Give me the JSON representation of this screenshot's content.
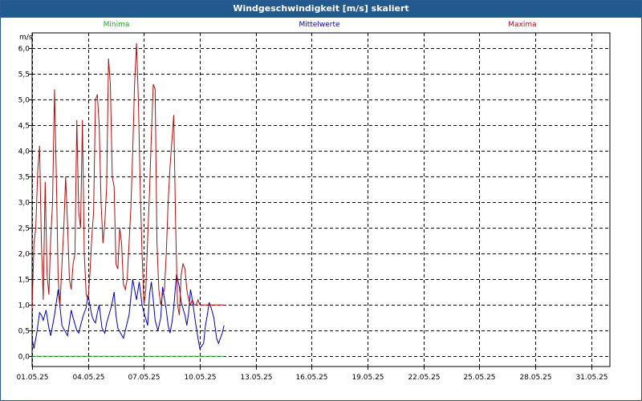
{
  "window": {
    "title": "Windgeschwindigkeit [m/s] skaliert"
  },
  "chart_data": {
    "type": "line",
    "title": "Windgeschwindigkeit [m/s] skaliert",
    "ylabel": "m/s",
    "ylim": [
      -0.2,
      6.3
    ],
    "xlim": [
      0,
      31
    ],
    "grid": true,
    "legend_placement": "top",
    "yticks": [
      0.0,
      0.5,
      1.0,
      1.5,
      2.0,
      2.5,
      3.0,
      3.5,
      4.0,
      4.5,
      5.0,
      5.5,
      6.0
    ],
    "ytick_labels": [
      "0,0",
      "0,5",
      "1,0",
      "1,5",
      "2,0",
      "2,5",
      "3,0",
      "3,5",
      "4,0",
      "4,5",
      "5,0",
      "5,5",
      "6,0"
    ],
    "xticks": [
      {
        "x": 0,
        "label": "01.05.25"
      },
      {
        "x": 3,
        "label": "04.05.25"
      },
      {
        "x": 6,
        "label": "07.05.25"
      },
      {
        "x": 9,
        "label": "10.05.25"
      },
      {
        "x": 12,
        "label": "13.05.25"
      },
      {
        "x": 15,
        "label": "16.05.25"
      },
      {
        "x": 18,
        "label": "19.05.25"
      },
      {
        "x": 21,
        "label": "22.05.25"
      },
      {
        "x": 24,
        "label": "25.05.25"
      },
      {
        "x": 27,
        "label": "28.05.25"
      },
      {
        "x": 30,
        "label": "31.05.25"
      }
    ],
    "series": [
      {
        "name": "Minima",
        "color": "#22aa22",
        "x": [
          0,
          10.3
        ],
        "y": [
          0.0,
          0.0
        ]
      },
      {
        "name": "Mittelwerte",
        "color": "#0000aa",
        "x": [
          0,
          0.1,
          0.25,
          0.4,
          0.5,
          0.6,
          0.75,
          0.9,
          1.0,
          1.2,
          1.4,
          1.6,
          1.75,
          1.9,
          2.0,
          2.1,
          2.2,
          2.4,
          2.5,
          2.6,
          2.75,
          2.9,
          3.0,
          3.2,
          3.3,
          3.4,
          3.5,
          3.6,
          3.75,
          3.9,
          4.0,
          4.2,
          4.3,
          4.4,
          4.5,
          4.6,
          4.75,
          4.9,
          5.0,
          5.2,
          5.3,
          5.4,
          5.5,
          5.6,
          5.75,
          5.9,
          6.0,
          6.2,
          6.3,
          6.4,
          6.5,
          6.6,
          6.75,
          6.9,
          7.0,
          7.2,
          7.3,
          7.4,
          7.5,
          7.6,
          7.75,
          7.9,
          8.0,
          8.2,
          8.3,
          8.4,
          8.5,
          8.6,
          8.75,
          8.9,
          9.0,
          9.2,
          9.3,
          9.4,
          9.5,
          9.6,
          9.75,
          9.9,
          10.0,
          10.2,
          10.3
        ],
        "y": [
          0.35,
          0.15,
          0.45,
          0.85,
          0.8,
          0.7,
          0.9,
          0.55,
          0.4,
          0.8,
          1.3,
          0.6,
          0.5,
          0.4,
          0.65,
          0.9,
          0.75,
          0.5,
          0.45,
          0.6,
          0.8,
          0.95,
          1.2,
          0.8,
          0.7,
          0.65,
          0.85,
          1.0,
          0.55,
          0.45,
          0.65,
          0.9,
          1.05,
          1.25,
          0.8,
          0.55,
          0.45,
          0.35,
          0.5,
          0.8,
          1.15,
          1.5,
          1.3,
          1.1,
          1.45,
          1.0,
          0.85,
          0.6,
          1.2,
          1.45,
          1.1,
          0.7,
          0.5,
          0.75,
          1.35,
          0.9,
          0.6,
          0.45,
          0.65,
          0.95,
          1.6,
          1.35,
          1.05,
          0.8,
          0.6,
          0.85,
          1.3,
          1.1,
          0.7,
          0.35,
          0.15,
          0.25,
          0.6,
          0.8,
          1.05,
          0.95,
          0.75,
          0.35,
          0.25,
          0.45,
          0.6
        ]
      },
      {
        "name": "Maxima",
        "color": "#aa1111",
        "x": [
          0,
          0.1,
          0.2,
          0.3,
          0.4,
          0.5,
          0.6,
          0.7,
          0.8,
          0.9,
          1.0,
          1.1,
          1.2,
          1.3,
          1.4,
          1.5,
          1.6,
          1.7,
          1.8,
          1.9,
          2.0,
          2.1,
          2.2,
          2.3,
          2.4,
          2.5,
          2.6,
          2.7,
          2.8,
          2.9,
          3.0,
          3.1,
          3.2,
          3.3,
          3.4,
          3.5,
          3.6,
          3.7,
          3.8,
          3.9,
          4.0,
          4.1,
          4.2,
          4.3,
          4.4,
          4.5,
          4.6,
          4.7,
          4.8,
          4.9,
          5.0,
          5.1,
          5.2,
          5.3,
          5.4,
          5.5,
          5.6,
          5.7,
          5.8,
          5.9,
          6.0,
          6.1,
          6.2,
          6.3,
          6.4,
          6.5,
          6.6,
          6.7,
          6.8,
          6.9,
          7.0,
          7.1,
          7.2,
          7.3,
          7.4,
          7.5,
          7.6,
          7.7,
          7.8,
          7.9,
          8.0,
          8.1,
          8.2,
          8.3,
          8.4,
          8.5,
          8.6,
          8.7,
          8.8,
          8.9,
          9.0,
          9.1,
          9.2,
          9.3,
          9.4,
          9.5,
          9.6,
          9.7,
          9.8,
          9.9,
          10.0,
          10.1,
          10.2,
          10.3
        ],
        "y": [
          0.9,
          2.2,
          2.5,
          3.6,
          4.1,
          2.2,
          1.1,
          3.4,
          1.6,
          1.2,
          2.3,
          3.0,
          5.2,
          3.5,
          1.5,
          1.0,
          1.8,
          2.5,
          3.5,
          2.6,
          1.5,
          1.3,
          1.8,
          2.0,
          4.6,
          2.8,
          2.5,
          4.6,
          2.0,
          1.2,
          1.1,
          1.6,
          2.3,
          2.8,
          5.0,
          5.1,
          4.5,
          3.0,
          2.2,
          2.6,
          3.3,
          5.8,
          5.3,
          3.5,
          3.3,
          1.8,
          1.7,
          2.5,
          2.2,
          1.4,
          1.3,
          1.5,
          2.2,
          2.9,
          4.0,
          5.3,
          6.1,
          5.0,
          3.3,
          2.0,
          1.0,
          1.3,
          2.3,
          3.2,
          4.3,
          5.3,
          5.2,
          2.2,
          1.3,
          1.0,
          1.2,
          1.3,
          2.0,
          3.0,
          3.7,
          4.2,
          4.7,
          2.6,
          1.0,
          0.8,
          1.6,
          1.8,
          1.7,
          1.3,
          1.1,
          1.0,
          1.1,
          1.0,
          1.0,
          1.1,
          1.0,
          1.0,
          1.0,
          1.0,
          1.0,
          1.0,
          1.0,
          1.0,
          1.0,
          1.0,
          1.0,
          1.0,
          1.0,
          1.0
        ]
      }
    ]
  }
}
